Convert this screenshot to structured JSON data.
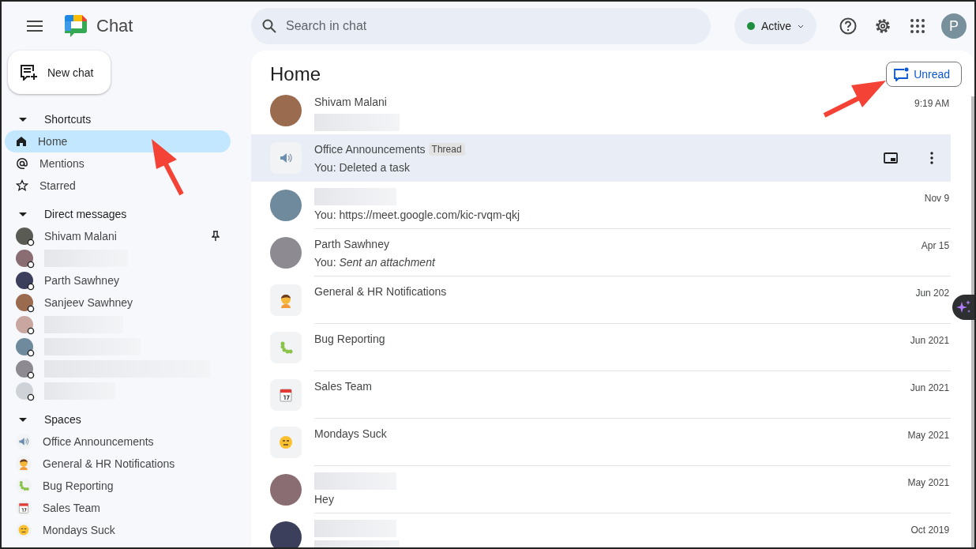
{
  "app": {
    "title": "Chat"
  },
  "search": {
    "placeholder": "Search in chat"
  },
  "status": {
    "label": "Active",
    "on": true
  },
  "account": {
    "initial": "P"
  },
  "new_chat": {
    "label": "New chat"
  },
  "sidebar": [
    {
      "title": "Shortcuts",
      "kind": "shortcuts",
      "expanded": true,
      "items": [
        {
          "kind": "named",
          "name": "Home",
          "selected": true
        },
        {
          "kind": "named",
          "name": "Mentions",
          "selected": false
        },
        {
          "kind": "named",
          "name": "Starred",
          "selected": false
        }
      ]
    },
    {
      "title": "Direct messages",
      "kind": "people",
      "expanded": true,
      "items": [
        {
          "kind": "named",
          "name": "Shivam Malani",
          "pinned": true,
          "selected": false
        },
        {
          "kind": "blurred",
          "pinned": false,
          "selected": false
        },
        {
          "kind": "named",
          "name": "Parth Sawhney",
          "pinned": false,
          "selected": false
        },
        {
          "kind": "named",
          "name": "Sanjeev Sawhney",
          "pinned": false,
          "selected": false
        },
        {
          "kind": "blurred",
          "pinned": false,
          "selected": false
        },
        {
          "kind": "blurred",
          "pinned": false,
          "selected": false
        },
        {
          "kind": "blurred",
          "pinned": false,
          "selected": false
        },
        {
          "kind": "blurred",
          "pinned": false,
          "selected": false
        }
      ]
    },
    {
      "title": "Spaces",
      "kind": "spaces",
      "expanded": true,
      "items": [
        {
          "kind": "named",
          "name": "Office Announcements",
          "selected": false
        },
        {
          "kind": "named",
          "name": "General & HR Notifications",
          "selected": false
        },
        {
          "kind": "named",
          "name": "Bug Reporting",
          "selected": false
        },
        {
          "kind": "named",
          "name": "Sales Team",
          "selected": false
        },
        {
          "kind": "named",
          "name": "Mondays Suck",
          "selected": false
        }
      ]
    }
  ],
  "main": {
    "title": "Home",
    "filter_button": "Unread",
    "conversations": [
      {
        "kind": "dm",
        "name": "Shivam Malani",
        "time": "9:19 AM",
        "selected": false
      },
      {
        "kind": "space",
        "name": "Office Announcements",
        "tag": "Thread",
        "preview": "You: Deleted a task",
        "selected": true
      },
      {
        "kind": "dm",
        "preview": "You: https://meet.google.com/kic-rvqm-qkj",
        "time": "Nov 9",
        "selected": false
      },
      {
        "kind": "dm",
        "name": "Parth Sawhney",
        "preview": "You: *Sent an attachment*",
        "time": "Apr 15",
        "selected": false
      },
      {
        "kind": "space",
        "name": "General & HR Notifications",
        "time": "Jun 202",
        "selected": false
      },
      {
        "kind": "space",
        "name": "Bug Reporting",
        "time": "Jun 2021",
        "selected": false
      },
      {
        "kind": "space",
        "name": "Sales Team",
        "time": "Jun 2021",
        "selected": false
      },
      {
        "kind": "space",
        "name": "Mondays Suck",
        "time": "May 2021",
        "selected": false
      },
      {
        "kind": "dm",
        "preview": "Hey",
        "time": "May 2021",
        "selected": false
      },
      {
        "kind": "dm",
        "time": "Oct 2019",
        "selected": false
      }
    ]
  }
}
